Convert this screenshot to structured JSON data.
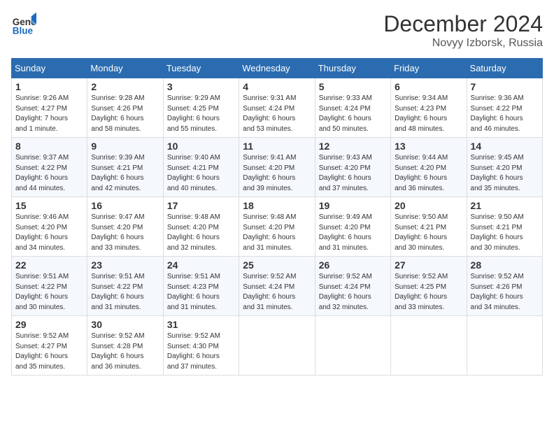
{
  "header": {
    "logo_general": "General",
    "logo_blue": "Blue",
    "month": "December 2024",
    "location": "Novyy Izborsk, Russia"
  },
  "days_of_week": [
    "Sunday",
    "Monday",
    "Tuesday",
    "Wednesday",
    "Thursday",
    "Friday",
    "Saturday"
  ],
  "weeks": [
    [
      {
        "day": 1,
        "info": "Sunrise: 9:26 AM\nSunset: 4:27 PM\nDaylight: 7 hours\nand 1 minute."
      },
      {
        "day": 2,
        "info": "Sunrise: 9:28 AM\nSunset: 4:26 PM\nDaylight: 6 hours\nand 58 minutes."
      },
      {
        "day": 3,
        "info": "Sunrise: 9:29 AM\nSunset: 4:25 PM\nDaylight: 6 hours\nand 55 minutes."
      },
      {
        "day": 4,
        "info": "Sunrise: 9:31 AM\nSunset: 4:24 PM\nDaylight: 6 hours\nand 53 minutes."
      },
      {
        "day": 5,
        "info": "Sunrise: 9:33 AM\nSunset: 4:24 PM\nDaylight: 6 hours\nand 50 minutes."
      },
      {
        "day": 6,
        "info": "Sunrise: 9:34 AM\nSunset: 4:23 PM\nDaylight: 6 hours\nand 48 minutes."
      },
      {
        "day": 7,
        "info": "Sunrise: 9:36 AM\nSunset: 4:22 PM\nDaylight: 6 hours\nand 46 minutes."
      }
    ],
    [
      {
        "day": 8,
        "info": "Sunrise: 9:37 AM\nSunset: 4:22 PM\nDaylight: 6 hours\nand 44 minutes."
      },
      {
        "day": 9,
        "info": "Sunrise: 9:39 AM\nSunset: 4:21 PM\nDaylight: 6 hours\nand 42 minutes."
      },
      {
        "day": 10,
        "info": "Sunrise: 9:40 AM\nSunset: 4:21 PM\nDaylight: 6 hours\nand 40 minutes."
      },
      {
        "day": 11,
        "info": "Sunrise: 9:41 AM\nSunset: 4:20 PM\nDaylight: 6 hours\nand 39 minutes."
      },
      {
        "day": 12,
        "info": "Sunrise: 9:43 AM\nSunset: 4:20 PM\nDaylight: 6 hours\nand 37 minutes."
      },
      {
        "day": 13,
        "info": "Sunrise: 9:44 AM\nSunset: 4:20 PM\nDaylight: 6 hours\nand 36 minutes."
      },
      {
        "day": 14,
        "info": "Sunrise: 9:45 AM\nSunset: 4:20 PM\nDaylight: 6 hours\nand 35 minutes."
      }
    ],
    [
      {
        "day": 15,
        "info": "Sunrise: 9:46 AM\nSunset: 4:20 PM\nDaylight: 6 hours\nand 34 minutes."
      },
      {
        "day": 16,
        "info": "Sunrise: 9:47 AM\nSunset: 4:20 PM\nDaylight: 6 hours\nand 33 minutes."
      },
      {
        "day": 17,
        "info": "Sunrise: 9:48 AM\nSunset: 4:20 PM\nDaylight: 6 hours\nand 32 minutes."
      },
      {
        "day": 18,
        "info": "Sunrise: 9:48 AM\nSunset: 4:20 PM\nDaylight: 6 hours\nand 31 minutes."
      },
      {
        "day": 19,
        "info": "Sunrise: 9:49 AM\nSunset: 4:20 PM\nDaylight: 6 hours\nand 31 minutes."
      },
      {
        "day": 20,
        "info": "Sunrise: 9:50 AM\nSunset: 4:21 PM\nDaylight: 6 hours\nand 30 minutes."
      },
      {
        "day": 21,
        "info": "Sunrise: 9:50 AM\nSunset: 4:21 PM\nDaylight: 6 hours\nand 30 minutes."
      }
    ],
    [
      {
        "day": 22,
        "info": "Sunrise: 9:51 AM\nSunset: 4:22 PM\nDaylight: 6 hours\nand 30 minutes."
      },
      {
        "day": 23,
        "info": "Sunrise: 9:51 AM\nSunset: 4:22 PM\nDaylight: 6 hours\nand 31 minutes."
      },
      {
        "day": 24,
        "info": "Sunrise: 9:51 AM\nSunset: 4:23 PM\nDaylight: 6 hours\nand 31 minutes."
      },
      {
        "day": 25,
        "info": "Sunrise: 9:52 AM\nSunset: 4:24 PM\nDaylight: 6 hours\nand 31 minutes."
      },
      {
        "day": 26,
        "info": "Sunrise: 9:52 AM\nSunset: 4:24 PM\nDaylight: 6 hours\nand 32 minutes."
      },
      {
        "day": 27,
        "info": "Sunrise: 9:52 AM\nSunset: 4:25 PM\nDaylight: 6 hours\nand 33 minutes."
      },
      {
        "day": 28,
        "info": "Sunrise: 9:52 AM\nSunset: 4:26 PM\nDaylight: 6 hours\nand 34 minutes."
      }
    ],
    [
      {
        "day": 29,
        "info": "Sunrise: 9:52 AM\nSunset: 4:27 PM\nDaylight: 6 hours\nand 35 minutes."
      },
      {
        "day": 30,
        "info": "Sunrise: 9:52 AM\nSunset: 4:28 PM\nDaylight: 6 hours\nand 36 minutes."
      },
      {
        "day": 31,
        "info": "Sunrise: 9:52 AM\nSunset: 4:30 PM\nDaylight: 6 hours\nand 37 minutes."
      },
      null,
      null,
      null,
      null
    ]
  ]
}
